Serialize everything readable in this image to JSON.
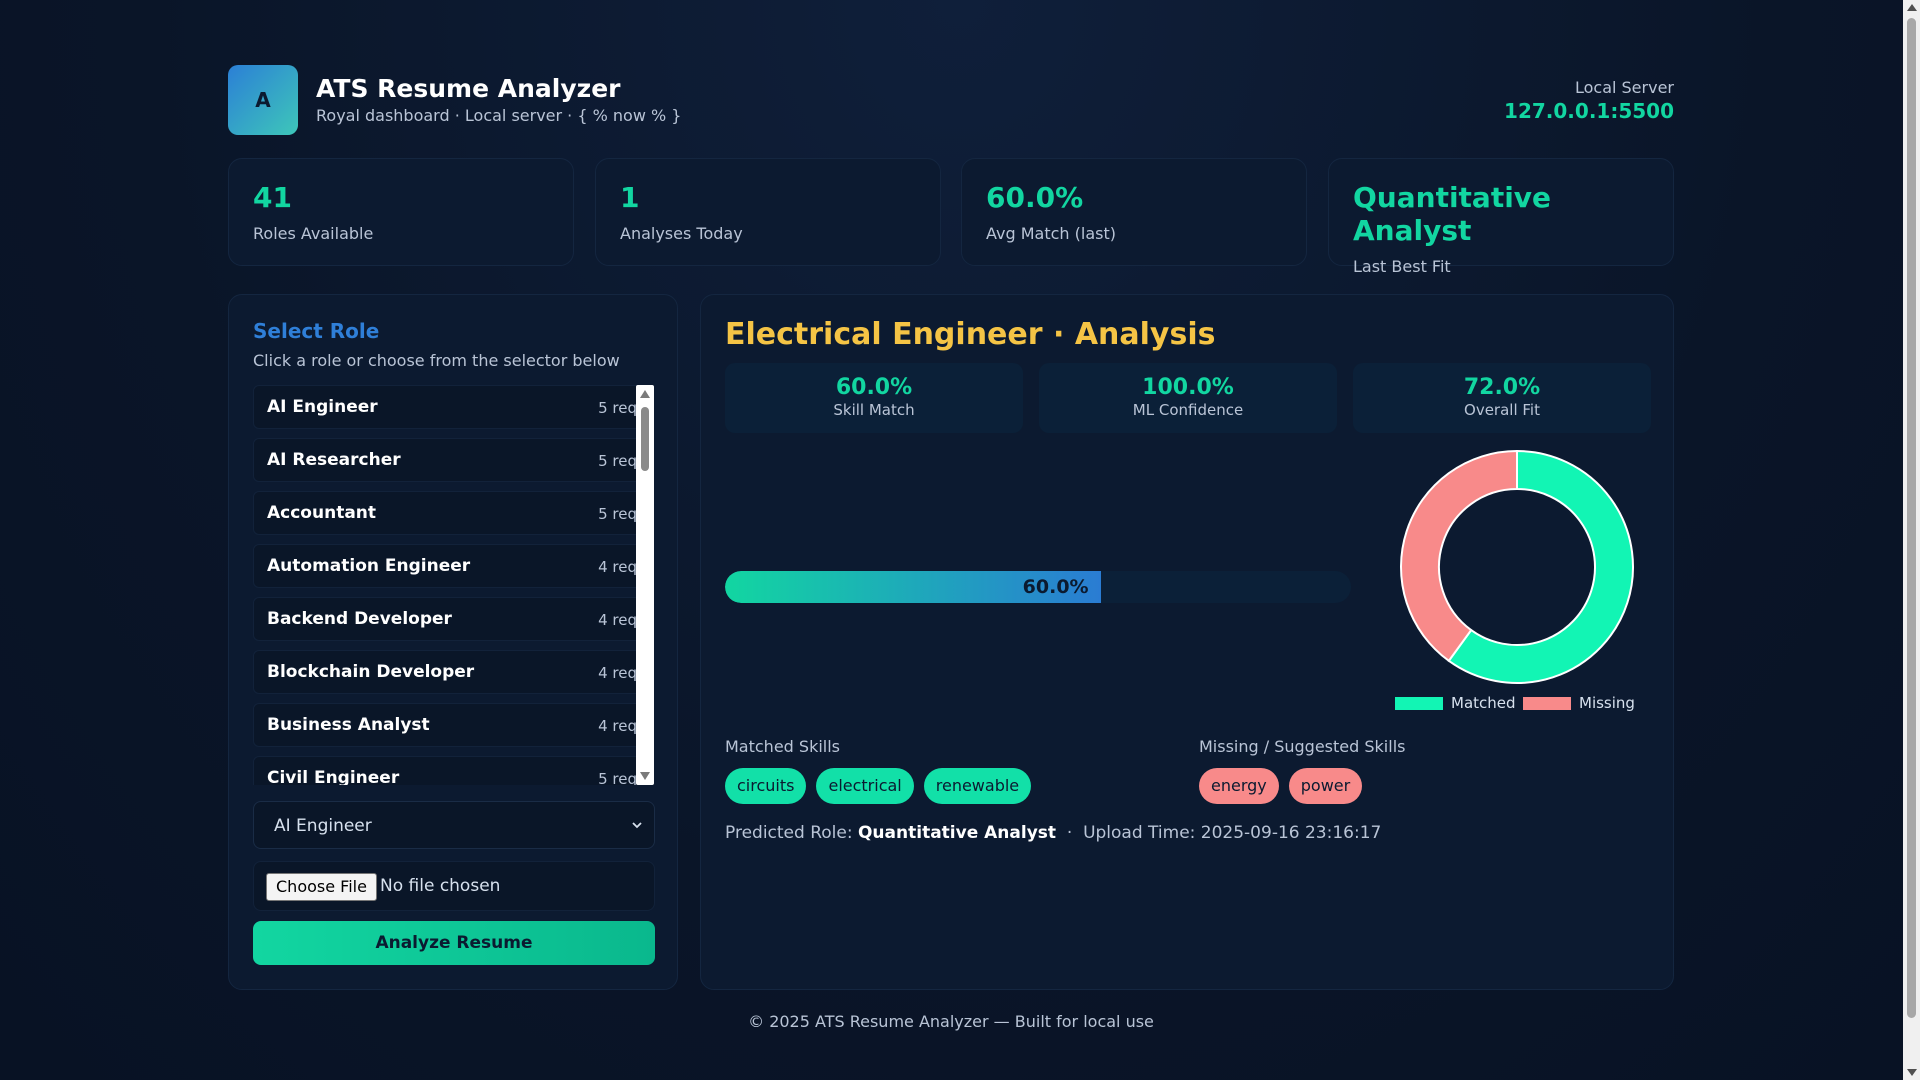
{
  "header": {
    "logo_letter": "A",
    "title": "ATS Resume Analyzer",
    "subtitle": "Royal dashboard · Local server · { % now % }",
    "server_label": "Local Server",
    "server_address": "127.0.0.1:5500"
  },
  "stats": [
    {
      "value": "41",
      "label": "Roles Available"
    },
    {
      "value": "1",
      "label": "Analyses Today"
    },
    {
      "value": "60.0%",
      "label": "Avg Match (last)"
    },
    {
      "value": "Quantitative Analyst",
      "label": "Last Best Fit"
    }
  ],
  "role_panel": {
    "title": "Select Role",
    "hint": "Click a role or choose from the selector below",
    "roles": [
      {
        "name": "AI Engineer",
        "req": "5 req"
      },
      {
        "name": "AI Researcher",
        "req": "5 req"
      },
      {
        "name": "Accountant",
        "req": "5 req"
      },
      {
        "name": "Automation Engineer",
        "req": "4 req"
      },
      {
        "name": "Backend Developer",
        "req": "4 req"
      },
      {
        "name": "Blockchain Developer",
        "req": "4 req"
      },
      {
        "name": "Business Analyst",
        "req": "4 req"
      },
      {
        "name": "Civil Engineer",
        "req": "5 req"
      }
    ],
    "selected_role": "AI Engineer",
    "file_button": "Choose File",
    "file_status": "No file chosen",
    "analyze_button": "Analyze Resume"
  },
  "analysis": {
    "title": "Electrical Engineer · Analysis",
    "metrics": [
      {
        "value": "60.0%",
        "label": "Skill Match"
      },
      {
        "value": "100.0%",
        "label": "ML Confidence"
      },
      {
        "value": "72.0%",
        "label": "Overall Fit"
      }
    ],
    "skill_match_fraction": 0.6,
    "skill_match_label": "60.0%",
    "matched_label": "Matched Skills",
    "matched_skills": [
      "circuits",
      "electrical",
      "renewable"
    ],
    "missing_label": "Missing / Suggested Skills",
    "missing_skills": [
      "energy",
      "power"
    ],
    "predicted_role_label": "Predicted Role:",
    "predicted_role": "Quantitative Analyst",
    "separator": "·",
    "upload_time": "Upload Time: 2025-09-16 23:16:17"
  },
  "chart_data": {
    "type": "pie",
    "categories": [
      "Matched",
      "Missing"
    ],
    "values": [
      3,
      2
    ],
    "colors": [
      "#12f5b4",
      "#f88a8a"
    ],
    "legend_position": "bottom"
  },
  "footer": {
    "copyright": "© 2025 ATS Resume Analyzer — Built for local use"
  }
}
